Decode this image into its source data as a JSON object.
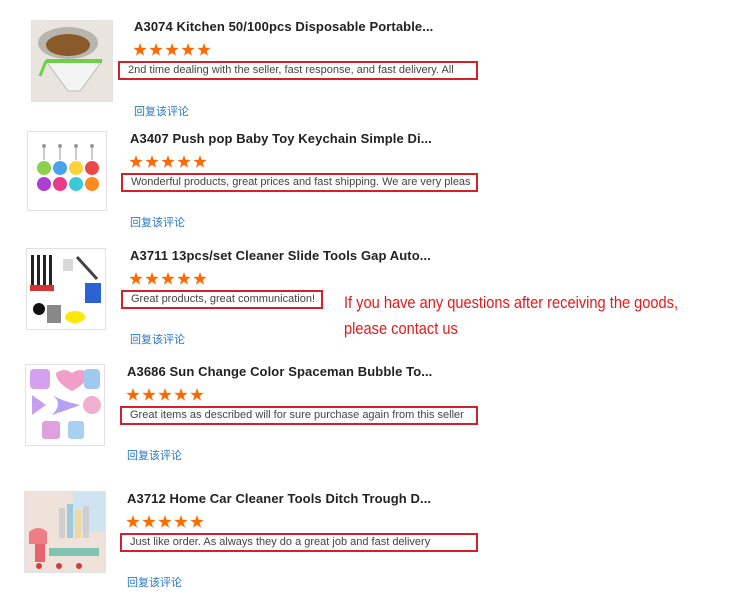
{
  "reviews": [
    {
      "title": "A3074 Kitchen 50/100pcs Disposable Portable...",
      "rating": 5,
      "comment": "2nd time dealing with the seller, fast response, and fast delivery. All",
      "reply_label": "回复该评论",
      "image_icon": "kitchen-strainer-bag-icon"
    },
    {
      "title": "A3407 Push pop Baby Toy Keychain Simple Di...",
      "rating": 5,
      "comment": "Wonderful products, great prices and fast shipping. We are very pleas",
      "reply_label": "回复该评论",
      "image_icon": "push-pop-keychain-icon"
    },
    {
      "title": "A3711 13pcs/set Cleaner Slide Tools Gap Auto...",
      "rating": 5,
      "comment": "Great products, great communication!",
      "reply_label": "回复该评论",
      "image_icon": "cleaning-brush-set-icon"
    },
    {
      "title": "A3686 Sun Change Color Spaceman Bubble To...",
      "rating": 5,
      "comment": "Great items as described will for sure purchase again from this seller",
      "reply_label": "回复该评论",
      "image_icon": "bubble-toy-icon"
    },
    {
      "title": "A3712 Home Car Cleaner Tools Ditch Trough D...",
      "rating": 5,
      "comment": "Just like order. As always they do a great job and fast delivery",
      "reply_label": "回复该评论",
      "image_icon": "car-cleaner-tools-icon"
    }
  ],
  "notice": {
    "line1": "If you have any questions after receiving the goods,",
    "line2": "please contact us"
  },
  "colors": {
    "star": "#ff6a00",
    "highlight_border": "#d4202a",
    "notice_text": "#e01b1b",
    "reply_link": "#2a78c5"
  }
}
